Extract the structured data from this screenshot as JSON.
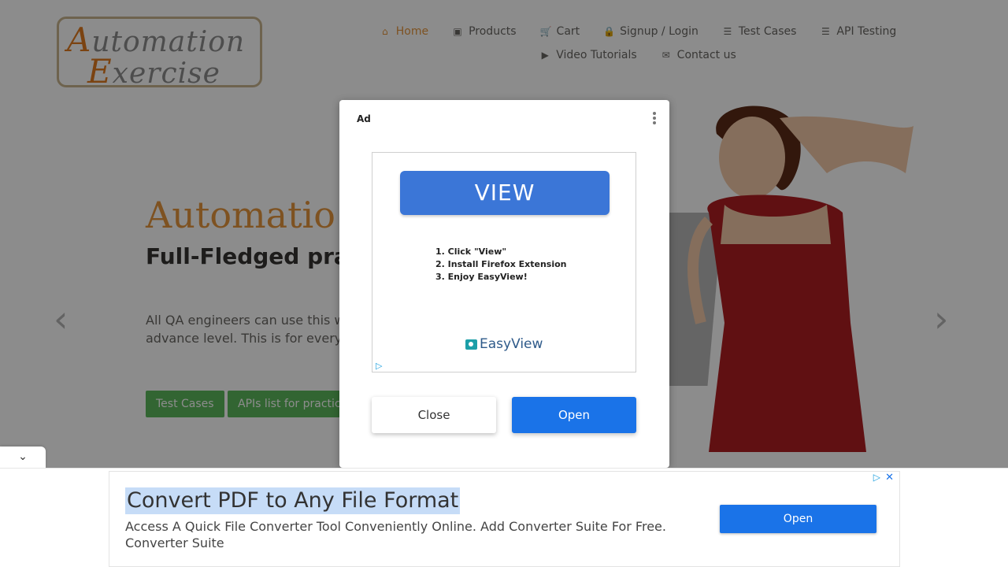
{
  "logo": {
    "line1_cap": "A",
    "line1_rest": "utomation",
    "line2_cap": "E",
    "line2_rest": "xercise"
  },
  "nav": {
    "row1": [
      {
        "label": "Home",
        "icon": "home-icon",
        "glyph": "⌂",
        "active": true
      },
      {
        "label": "Products",
        "icon": "briefcase-icon",
        "glyph": "▣"
      },
      {
        "label": "Cart",
        "icon": "cart-icon",
        "glyph": "🛒"
      },
      {
        "label": "Signup / Login",
        "icon": "lock-icon",
        "glyph": "🔒"
      },
      {
        "label": "Test Cases",
        "icon": "list-icon",
        "glyph": "☰"
      },
      {
        "label": "API Testing",
        "icon": "list-icon",
        "glyph": "☰"
      }
    ],
    "row2": [
      {
        "label": "Video Tutorials",
        "icon": "youtube-icon",
        "glyph": "▶"
      },
      {
        "label": "Contact us",
        "icon": "envelope-icon",
        "glyph": "✉"
      }
    ]
  },
  "hero": {
    "title": "Automatio",
    "subtitle": "Full-Fledged pra for Automation",
    "description": "All QA engineers can use this w practice and API testing either advance level. This is for every their automation skills.",
    "btn_test_cases": "Test Cases",
    "btn_apis": "APIs list for practic"
  },
  "modal": {
    "ad_label": "Ad",
    "view_label": "VIEW",
    "steps": [
      "1. Click \"View\"",
      "2. Install Firefox Extension",
      "3. Enjoy EasyView!"
    ],
    "brand": "EasyView",
    "close_label": "Close",
    "open_label": "Open"
  },
  "bottom_ad": {
    "title": "Convert PDF to Any File Format",
    "description": "Access A Quick File Converter Tool Conveniently Online. Add Converter Suite For Free. Converter Suite",
    "open_label": "Open",
    "adchoices_glyph": "▷",
    "close_glyph": "✕"
  },
  "carousel": {
    "prev": "‹",
    "next": "›"
  },
  "colors": {
    "accent": "#e5963d",
    "button_green": "#5cb85c",
    "open_blue": "#1a73e8"
  }
}
